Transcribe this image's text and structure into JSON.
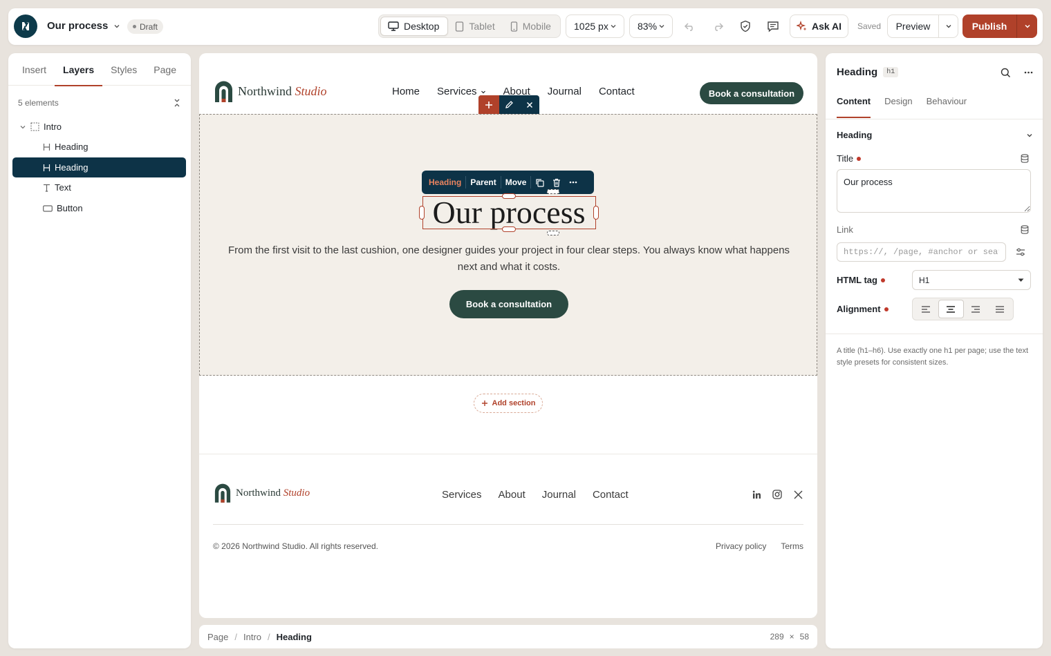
{
  "topbar": {
    "document_title": "Our process",
    "status_badge": "Draft",
    "devices": [
      {
        "label": "Desktop",
        "icon": "desktop-icon",
        "active": true
      },
      {
        "label": "Tablet",
        "icon": "tablet-icon",
        "active": false
      },
      {
        "label": "Mobile",
        "icon": "mobile-icon",
        "active": false
      }
    ],
    "viewport_width": "1025 px",
    "zoom": "83%",
    "ask_ai_label": "Ask AI",
    "saved_label": "Saved",
    "preview_label": "Preview",
    "publish_label": "Publish"
  },
  "left_panel": {
    "tabs": [
      "Insert",
      "Layers",
      "Styles",
      "Page"
    ],
    "active_tab": "Layers",
    "element_count": "5 elements",
    "layers": [
      {
        "label": "Intro",
        "icon": "section-icon",
        "level": 0,
        "selected": false
      },
      {
        "label": "Heading",
        "icon": "heading-icon",
        "level": 1,
        "selected": false
      },
      {
        "label": "Heading",
        "icon": "heading-icon",
        "level": 1,
        "selected": true
      },
      {
        "label": "Text",
        "icon": "text-icon",
        "level": 1,
        "selected": false
      },
      {
        "label": "Button",
        "icon": "button-icon",
        "level": 1,
        "selected": false
      }
    ]
  },
  "canvas": {
    "brand": {
      "name": "Northwind",
      "accent": "Studio"
    },
    "nav": [
      "Home",
      "Services",
      "About",
      "Journal",
      "Contact"
    ],
    "header_cta": "Book a consultation",
    "element_toolbar": {
      "crumb": "Heading",
      "parent": "Parent",
      "move": "Move"
    },
    "hero": {
      "heading": "Our process",
      "text": "From the first visit to the last cushion, one designer guides your project in four clear steps. You always know what happens next and what it costs.",
      "cta": "Book a consultation"
    },
    "add_section": "Add section",
    "footer": {
      "nav": [
        "Services",
        "About",
        "Journal",
        "Contact"
      ],
      "social": [
        "linkedin-icon",
        "instagram-icon",
        "x-icon"
      ],
      "copyright": "© 2026 Northwind Studio. All rights reserved.",
      "legal": [
        "Privacy policy",
        "Terms"
      ]
    }
  },
  "statusbar": {
    "breadcrumb": [
      "Page",
      "Intro",
      "Heading"
    ],
    "width": "289",
    "times": "×",
    "height": "58"
  },
  "right_panel": {
    "title": "Heading",
    "tag": "h1",
    "tabs": [
      "Content",
      "Design",
      "Behaviour"
    ],
    "active_tab": "Content",
    "section_title": "Heading",
    "title_label": "Title",
    "title_value": "Our process",
    "link_label": "Link",
    "link_placeholder": "https://, /page, #anchor or search",
    "html_tag_label": "HTML tag",
    "html_tag_value": "H1",
    "alignment_label": "Alignment",
    "alignment_options": [
      "left",
      "center",
      "right",
      "justify"
    ],
    "alignment_active": "center",
    "help_text": "A title (h1–h6). Use exactly one h1 per page; use the text style presets for consistent sizes."
  },
  "colors": {
    "accent": "#b0412a",
    "dark_teal": "#0d3347",
    "forest": "#2b4a42",
    "hero_bg": "#f3efe9"
  }
}
